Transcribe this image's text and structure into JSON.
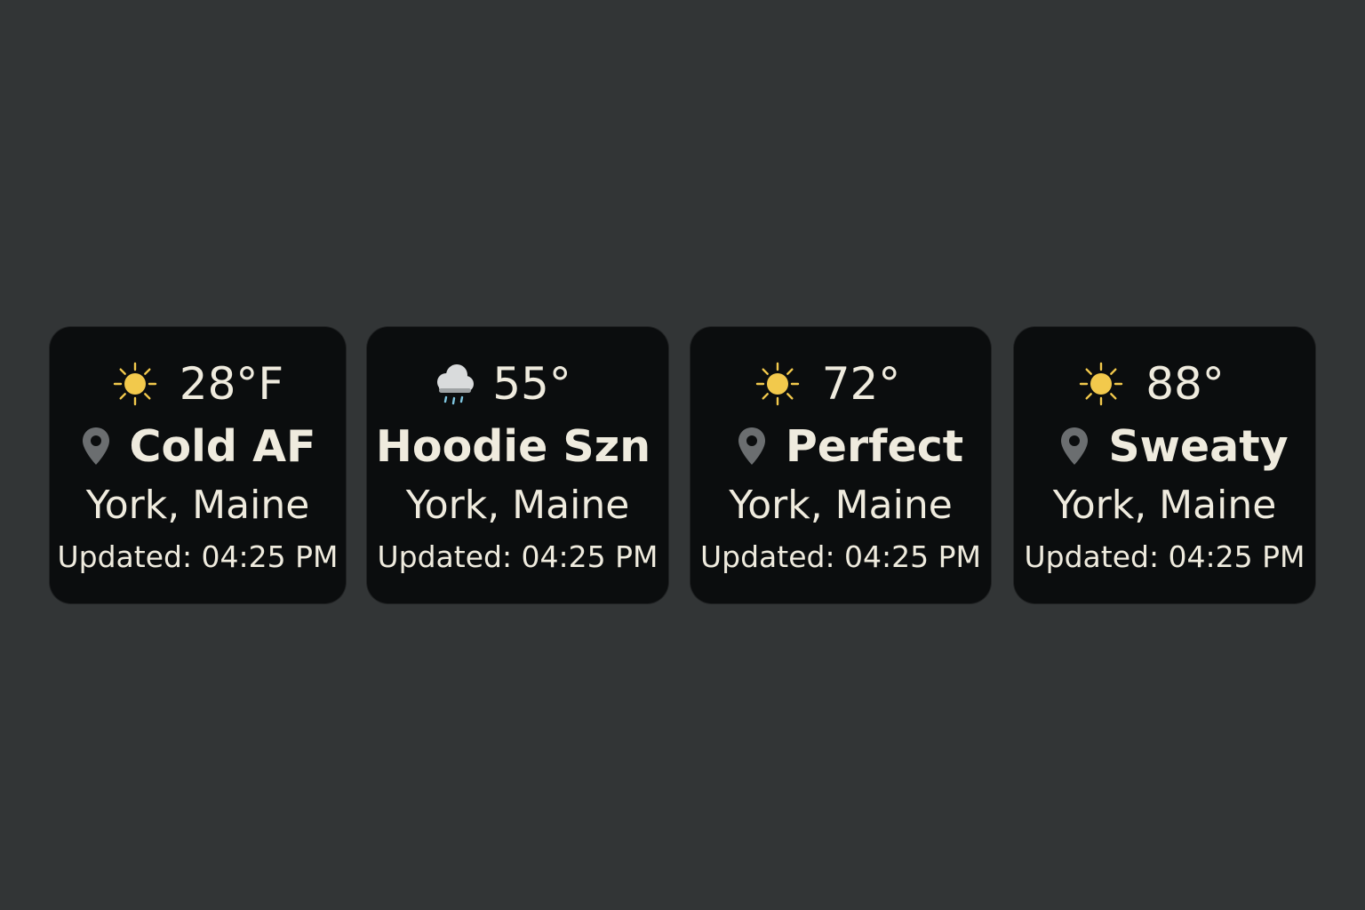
{
  "colors": {
    "background": "#323536",
    "card": "#0b0d0e",
    "text": "#efebde",
    "sun": "#f2c94c",
    "pin": "#6b6e70",
    "cloud": "#d9dbdc",
    "rain": "#7fc6e0"
  },
  "widgets": [
    {
      "weather_icon": "sun-icon",
      "temperature": "28°F",
      "location_icon": "location-pin-icon",
      "mood": "Cold AF",
      "city": "York, Maine",
      "updated": "Updated: 04:25 PM"
    },
    {
      "weather_icon": "rain-cloud-icon",
      "temperature": "55°",
      "location_icon": "",
      "mood": "Hoodie Szn",
      "city": "York, Maine",
      "updated": "Updated: 04:25 PM"
    },
    {
      "weather_icon": "sun-icon",
      "temperature": "72°",
      "location_icon": "location-pin-icon",
      "mood": "Perfect",
      "city": "York, Maine",
      "updated": "Updated: 04:25 PM"
    },
    {
      "weather_icon": "sun-icon",
      "temperature": "88°",
      "location_icon": "location-pin-icon",
      "mood": "Sweaty",
      "city": "York, Maine",
      "updated": "Updated: 04:25 PM"
    }
  ]
}
